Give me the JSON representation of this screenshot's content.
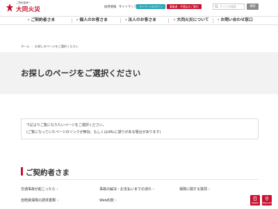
{
  "header": {
    "logo_tagline": "ご契約者様へ",
    "logo_name": "大同火災",
    "utility_links": [
      "採用情報",
      "サイトマップ"
    ],
    "pills": [
      {
        "label": "マイページログイン",
        "color": "#2aa7b8"
      },
      {
        "label": "事業者・代理店のご案内",
        "color": "#c8102e"
      }
    ],
    "search_placeholder": "サイト内検索",
    "search_button": "検索"
  },
  "nav": {
    "items": [
      {
        "label": "ご契約者さま"
      },
      {
        "label": "個人のお客さま"
      },
      {
        "label": "法人のお客さま"
      },
      {
        "label": "大同火災について"
      },
      {
        "label": "お問い合わせ窓口"
      }
    ]
  },
  "breadcrumb": {
    "home": "ホーム",
    "current": "お探しのページをご選択ください"
  },
  "main": {
    "title": "お探しのページをご選択ください",
    "notice_line1": "下記よりご覧になりたいページをご選択ください。",
    "notice_line2": "(ご覧になっていたページのリンクが無効、もしくはURLに誤りがある場合があります)"
  },
  "section": {
    "title": "ご契約者さま",
    "links": [
      {
        "label": "交通事故が起こったら"
      },
      {
        "label": "事故の解決・お支払いまでの流れ"
      },
      {
        "label": "保険に関する質問"
      },
      {
        "label": "自賠責保険の請求書類"
      },
      {
        "label": "Web約款"
      }
    ]
  },
  "floating": {
    "buttons": [
      {
        "label": "資料請求",
        "icon": "document-icon"
      },
      {
        "label": "代理店を探す",
        "icon": "pin-icon"
      }
    ]
  },
  "colors": {
    "brand_red": "#c8102e",
    "teal": "#2aa7b8",
    "band_gray": "#f2f2f2"
  }
}
